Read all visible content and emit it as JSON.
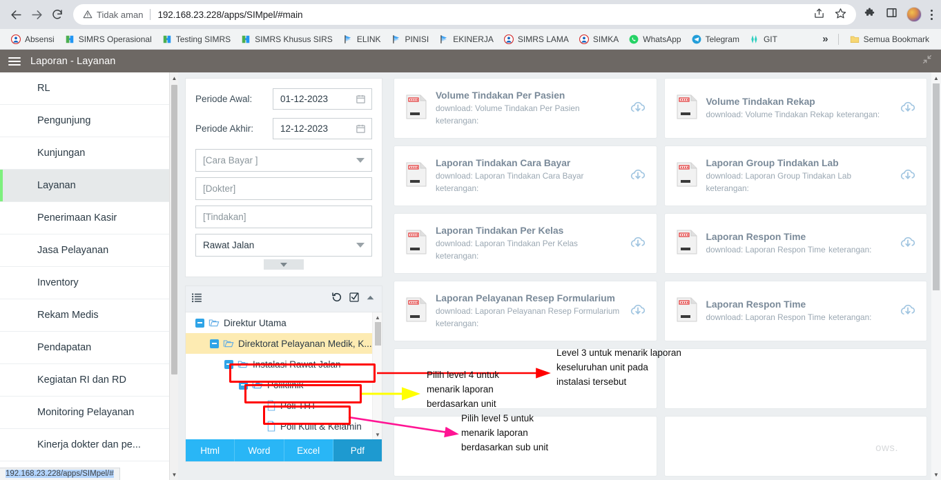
{
  "browser": {
    "back_title": "Back",
    "forward_title": "Forward",
    "reload_title": "Reload",
    "security_label": "Tidak aman",
    "url": "192.168.23.228/apps/SIMpel/#main",
    "share_title": "Share",
    "bookmark_title": "Bookmark this tab",
    "extensions_title": "Extensions",
    "sidepanel_title": "Side panel",
    "profile_title": "Profile",
    "menu_title": "Customize and control Google Chrome",
    "status_url": "192.168.23.228/apps/SIMpel/#"
  },
  "bookmarks": {
    "items": [
      {
        "label": "Absensi",
        "icon": "user-circle-icon"
      },
      {
        "label": "SIMRS Operasional",
        "icon": "puzzle-green-icon"
      },
      {
        "label": "Testing SIMRS",
        "icon": "puzzle-green-icon"
      },
      {
        "label": "SIMRS Khusus SIRS",
        "icon": "puzzle-green-icon"
      },
      {
        "label": "ELINK",
        "icon": "flag-blue-icon"
      },
      {
        "label": "PINISI",
        "icon": "flag-blue-icon"
      },
      {
        "label": "EKINERJA",
        "icon": "flag-blue-icon"
      },
      {
        "label": "SIMRS LAMA",
        "icon": "user-circle-icon"
      },
      {
        "label": "SIMKA",
        "icon": "user-circle-icon"
      },
      {
        "label": "WhatsApp",
        "icon": "whatsapp-icon"
      },
      {
        "label": "Telegram",
        "icon": "telegram-icon"
      },
      {
        "label": "GIT",
        "icon": "git-icon"
      }
    ],
    "overflow_label": "»",
    "all_bookmarks_label": "Semua Bookmark",
    "all_bookmarks_icon": "folder-icon"
  },
  "app": {
    "menu_icon": "hamburger-icon",
    "title": "Laporan - Layanan",
    "collapse_icon": "collapse-arrows-icon"
  },
  "sidebar": {
    "items": [
      {
        "label": "RL",
        "active": false
      },
      {
        "label": "Pengunjung",
        "active": false
      },
      {
        "label": "Kunjungan",
        "active": false
      },
      {
        "label": "Layanan",
        "active": true
      },
      {
        "label": "Penerimaan Kasir",
        "active": false
      },
      {
        "label": "Jasa Pelayanan",
        "active": false
      },
      {
        "label": "Inventory",
        "active": false
      },
      {
        "label": "Rekam Medis",
        "active": false
      },
      {
        "label": "Pendapatan",
        "active": false
      },
      {
        "label": "Kegiatan RI dan RD",
        "active": false
      },
      {
        "label": "Monitoring Pelayanan",
        "active": false
      },
      {
        "label": "Kinerja dokter dan pe...",
        "active": false
      }
    ],
    "accent_color": "#7ef07e"
  },
  "filters": {
    "periode_awal": {
      "label": "Periode Awal:",
      "value": "01-12-2023",
      "icon": "calendar-icon"
    },
    "periode_akhir": {
      "label": "Periode Akhir:",
      "value": "12-12-2023",
      "icon": "calendar-icon"
    },
    "cara_bayar": {
      "value": "[Cara Bayar ]",
      "is_placeholder": true,
      "icon": "chevron-down-icon"
    },
    "dokter": {
      "value": "[Dokter]",
      "is_placeholder": true
    },
    "tindakan": {
      "value": "[Tindakan]",
      "is_placeholder": true
    },
    "jenis_layanan": {
      "value": "Rawat Jalan",
      "is_placeholder": false,
      "icon": "chevron-down-icon"
    },
    "more_icon": "chevron-down-icon"
  },
  "tree": {
    "header": {
      "list_icon": "list-icon",
      "reset_icon": "history-undo-icon",
      "checkall_icon": "check-square-icon",
      "collapse_icon": "chevron-up-icon"
    },
    "nodes": [
      {
        "label": "Direktur Utama",
        "level": 0,
        "type": "folder",
        "expandable": true,
        "highlight": "none"
      },
      {
        "label": "Direktorat Pelayanan Medik, K...",
        "level": 1,
        "type": "folder",
        "expandable": true,
        "highlight": "yellow"
      },
      {
        "label": "Instalasi Rawat Jalan",
        "level": 2,
        "type": "folder",
        "expandable": true,
        "highlight": "none"
      },
      {
        "label": "Poliklinik",
        "level": 3,
        "type": "folder",
        "expandable": true,
        "highlight": "none"
      },
      {
        "label": "Poli THT",
        "level": 4,
        "type": "file",
        "expandable": false,
        "highlight": "none"
      },
      {
        "label": "Poli Kulit & Kelamin",
        "level": 4,
        "type": "file",
        "expandable": false,
        "highlight": "none"
      }
    ]
  },
  "export_buttons": [
    {
      "label": "Html",
      "active": false
    },
    {
      "label": "Word",
      "active": false
    },
    {
      "label": "Excel",
      "active": false
    },
    {
      "label": "Pdf",
      "active": true
    }
  ],
  "reports": {
    "download_prefix": "download: ",
    "keterangan_label": "keterangan:",
    "cards": [
      {
        "title": "Volume Tindakan Per Pasien",
        "download": "download: Volume Tindakan Per Pasien",
        "keterangan": "keterangan:"
      },
      {
        "title": "Volume Tindakan Rekap",
        "download": "download: Volume Tindakan Rekap",
        "keterangan": "keterangan:"
      },
      {
        "title": "Laporan Tindakan Cara Bayar",
        "download": "download: Laporan Tindakan Cara Bayar",
        "keterangan": "keterangan:"
      },
      {
        "title": "Laporan Group Tindakan Lab",
        "download": "download: Laporan Group Tindakan Lab",
        "keterangan": "keterangan:"
      },
      {
        "title": "Laporan Tindakan Per Kelas",
        "download": "download: Laporan Tindakan Per Kelas",
        "keterangan": "keterangan:"
      },
      {
        "title": "Laporan Respon Time",
        "download": "download: Laporan Respon Time",
        "keterangan": "keterangan:"
      },
      {
        "title": "Laporan Pelayanan Resep Formularium",
        "download": "download: Laporan Pelayanan Resep Formularium",
        "keterangan": "keterangan:"
      },
      {
        "title": "Laporan Respon Time",
        "download": "download: Laporan Respon Time",
        "keterangan": "keterangan:"
      }
    ],
    "watermark": "ows."
  },
  "annotations": {
    "level3": {
      "text": "Level 3 untuk menarik laporan\nkeseluruhan unit pada\ninstalasi tersebut",
      "arrow_color": "#ff0000"
    },
    "level4": {
      "text": "Pilih level 4 untuk\nmenarik laporan\nberdasarkan unit",
      "arrow_color": "#ffff00"
    },
    "level5": {
      "text": "Pilih level 5 untuk\nmenarik laporan\nberdasarkan sub unit",
      "arrow_color": "#ff1493"
    },
    "box_color": "#ff0000"
  }
}
